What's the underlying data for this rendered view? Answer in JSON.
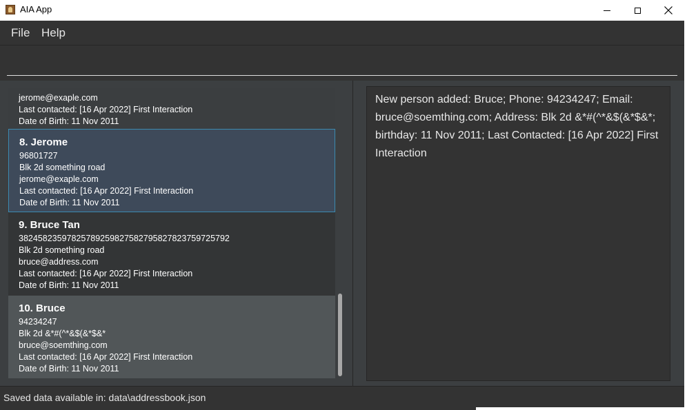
{
  "window": {
    "title": "AIA App"
  },
  "menu": {
    "file": "File",
    "help": "Help"
  },
  "command": {
    "value": ""
  },
  "persons": [
    {
      "index_name": "",
      "phone": "",
      "address": "",
      "email": "jerome@exaple.com",
      "last_contacted": "Last contacted: [16 Apr 2022] First Interaction",
      "birthday": "Date of Birth: 11 Nov 2011"
    },
    {
      "index_name": "8.  Jerome",
      "phone": "96801727",
      "address": "Blk 2d something road",
      "email": "jerome@exaple.com",
      "last_contacted": "Last contacted: [16 Apr 2022] First Interaction",
      "birthday": "Date of Birth: 11 Nov 2011"
    },
    {
      "index_name": "9.  Bruce Tan",
      "phone": "38245823597825789259827582795827823759725792",
      "address": "Blk 2d something road",
      "email": "bruce@address.com",
      "last_contacted": "Last contacted: [16 Apr 2022] First Interaction",
      "birthday": "Date of Birth: 11 Nov 2011"
    },
    {
      "index_name": "10.  Bruce",
      "phone": "94234247",
      "address": "Blk 2d &*#(^*&$(&*$&*",
      "email": "bruce@soemthing.com",
      "last_contacted": "Last contacted: [16 Apr 2022] First Interaction",
      "birthday": "Date of Birth: 11 Nov 2011"
    }
  ],
  "result": {
    "message": "New person added: Bruce; Phone: 94234247; Email: bruce@soemthing.com; Address: Blk 2d &*#(^*&$(&*$&*; birthday: 11 Nov 2011; Last Contacted: [16 Apr 2022] First Interaction"
  },
  "status": {
    "text": "Saved data available in: data\\addressbook.json"
  },
  "colors": {
    "selected_card": "#3e4a5a",
    "selected_border": "#3c8ab0",
    "background": "#3c3f41"
  }
}
